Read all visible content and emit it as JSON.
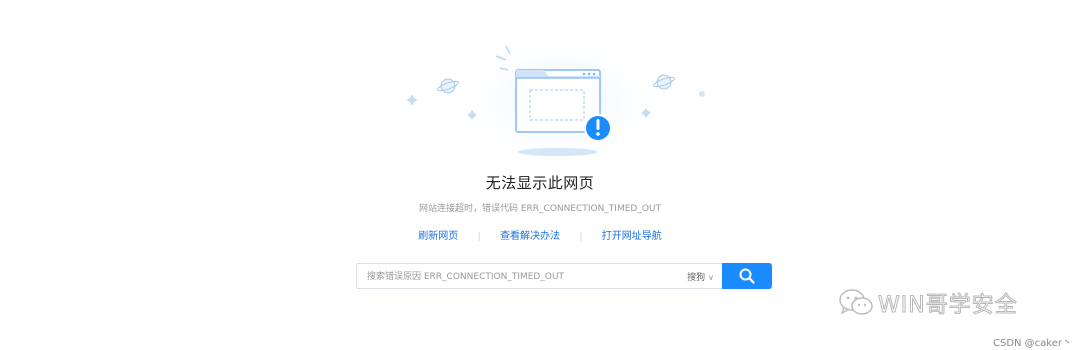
{
  "error": {
    "title": "无法显示此网页",
    "subtitle": "网站连接超时，错误代码 ERR_CONNECTION_TIMED_OUT"
  },
  "links": [
    {
      "label": "刷新网页"
    },
    {
      "label": "查看解决办法"
    },
    {
      "label": "打开网址导航"
    }
  ],
  "links_separator": "|",
  "search": {
    "placeholder": "搜索错误原因 ERR_CONNECTION_TIMED_OUT",
    "engine": "搜狗",
    "engine_chevron": "∨"
  },
  "watermark": {
    "text": "WIN哥学安全",
    "icon": "wechat-icon"
  },
  "footer": {
    "credit": "CSDN @caker丶"
  },
  "colors": {
    "accent": "#1a8cff",
    "link": "#1a73e8",
    "title": "#222222",
    "subtitle": "#999999",
    "illustration_blue": "#7db8f5"
  }
}
